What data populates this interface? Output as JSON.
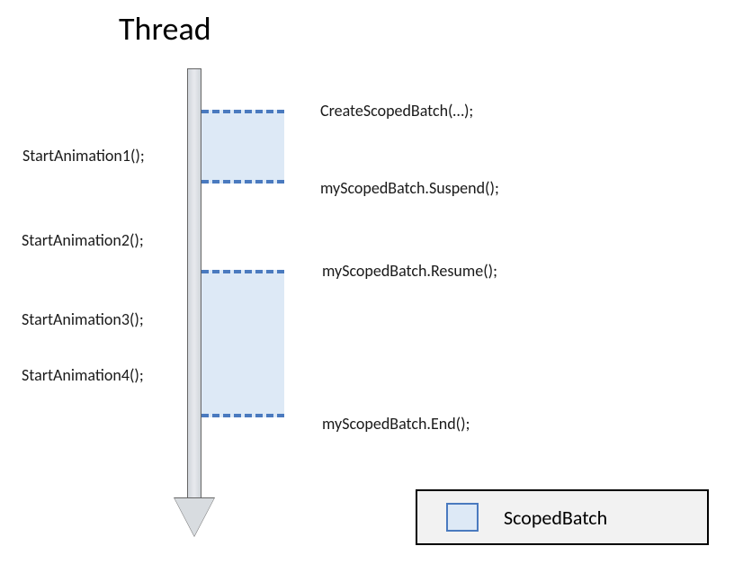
{
  "title": "Thread",
  "left_labels": {
    "sa1": "StartAnimation1();",
    "sa2": "StartAnimation2();",
    "sa3": "StartAnimation3();",
    "sa4": "StartAnimation4();"
  },
  "right_labels": {
    "create": "CreateScopedBatch(…);",
    "suspend": "myScopedBatch.Suspend();",
    "resume": "myScopedBatch.Resume();",
    "end": "myScopedBatch.End();"
  },
  "legend": {
    "label": "ScopedBatch"
  }
}
